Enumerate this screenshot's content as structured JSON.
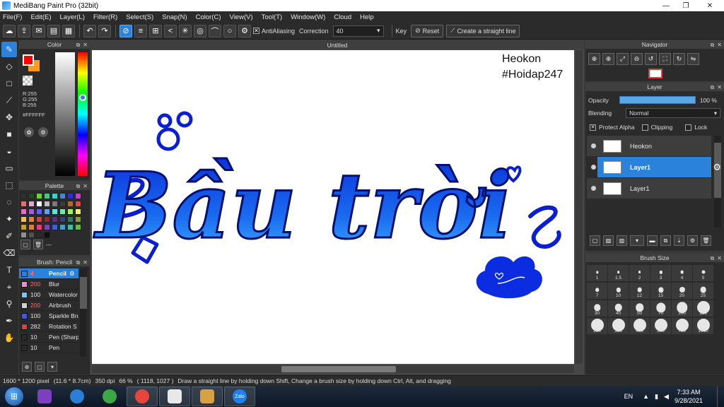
{
  "window": {
    "title": "MediBang Paint Pro (32bit)",
    "minimize": "—",
    "maximize": "❐",
    "close": "✕"
  },
  "menu": [
    "File(F)",
    "Edit(E)",
    "Layer(L)",
    "Filter(R)",
    "Select(S)",
    "Snap(N)",
    "Color(C)",
    "View(V)",
    "Tool(T)",
    "Window(W)",
    "Cloud",
    "Help"
  ],
  "toolbar": {
    "antialiasing_label": "AntiAliasing",
    "antialiasing_checked": true,
    "correction_label": "Correction",
    "correction_value": "40",
    "key_label": "Key",
    "reset_label": "Reset",
    "straight_line_label": "Create a straight line"
  },
  "color_panel": {
    "title": "Color",
    "r": "R:255",
    "g": "G:255",
    "b": "B:255",
    "hex": "#FFFFFF",
    "foreground": "#ff0000",
    "background": "#ff9a1a"
  },
  "palette_panel": {
    "title": "Palette",
    "more": "---",
    "colors": [
      "#2f2f2f",
      "#1f4a1f",
      "#6bd23e",
      "#38cf7f",
      "#3ad0d0",
      "#3a8ae0",
      "#2f2fd0",
      "#d03ad0",
      "#e07070",
      "#f0a0d0",
      "#ffffff",
      "#c0c0c0",
      "#7a7a7a",
      "#3a3a3a",
      "#b06a2a",
      "#f04040",
      "#e070c0",
      "#a060e0",
      "#6060f0",
      "#60a0f0",
      "#60e0e0",
      "#60f0a0",
      "#a0f060",
      "#f0f060",
      "#f0c060",
      "#f07a30",
      "#d04040",
      "#a02030",
      "#603080",
      "#304080",
      "#208060",
      "#80a030",
      "#c0a030",
      "#e08030",
      "#e04080",
      "#8040c0",
      "#4060d0",
      "#40a0d0",
      "#40c0a0",
      "#60c040",
      "#909090",
      "#505050",
      "#2a2a2a",
      "#101010"
    ]
  },
  "brush_panel": {
    "title": "Brush: Pencil",
    "items": [
      {
        "size": "4",
        "name": "Pencil",
        "color": "#2a82da",
        "size_color": "#ff6b6b",
        "active": true
      },
      {
        "size": "200",
        "name": "Blur",
        "color": "#f08ad8",
        "size_color": "#ff6b6b",
        "active": false
      },
      {
        "size": "100",
        "name": "Watercolor",
        "color": "#74c6ff",
        "size_color": "#e6e6e6",
        "active": false
      },
      {
        "size": "200",
        "name": "Airbrush",
        "color": "#d0d0d0",
        "size_color": "#ff6b6b",
        "active": false
      },
      {
        "size": "100",
        "name": "Sparkle Brush",
        "color": "#3a5ae0",
        "size_color": "#e6e6e6",
        "active": false
      },
      {
        "size": "282",
        "name": "Rotation S",
        "color": "#e04040",
        "size_color": "#e6e6e6",
        "active": false
      },
      {
        "size": "10",
        "name": "Pen (Sharp)",
        "color": "#2a2a2a",
        "size_color": "#e6e6e6",
        "active": false
      },
      {
        "size": "10",
        "name": "Pen",
        "color": "#2a2a2a",
        "size_color": "#e6e6e6",
        "active": false
      }
    ]
  },
  "document": {
    "tab_title": "Untitled",
    "watermark_line1": "Heokon",
    "watermark_line2": "#Hoidap247",
    "artwork_text": "Bầu trời"
  },
  "navigator": {
    "title": "Navigator"
  },
  "layer_panel": {
    "title": "Layer",
    "opacity_label": "Opacity",
    "opacity_value": "100 %",
    "opacity_percent": 100,
    "blending_label": "Blending",
    "blending_value": "Normal",
    "protect_alpha": "Protect Alpha",
    "protect_alpha_checked": true,
    "clipping": "Clipping",
    "lock": "Lock",
    "layers": [
      {
        "name": "Heokon",
        "active": false
      },
      {
        "name": "Layer1",
        "active": true
      },
      {
        "name": "Layer1",
        "active": false
      }
    ]
  },
  "brush_size_panel": {
    "title": "Brush Size",
    "sizes": [
      "1",
      "1.5",
      "2",
      "3",
      "4",
      "5",
      "7",
      "10",
      "12",
      "15",
      "20",
      "25",
      "30",
      "40",
      "50",
      "70",
      "100",
      "150",
      "200",
      "300",
      "400",
      "500",
      "700",
      "1000"
    ]
  },
  "status": {
    "pixels": "1600 * 1200 pixel",
    "cm": "(11.6 * 8.7cm)",
    "dpi": "350 dpi",
    "zoom": "66 %",
    "coords": "( 1118, 1027 )",
    "hint": "Draw a straight line by holding down Shift, Change a brush size by holding down Ctrl, Alt, and dragging"
  },
  "taskbar": {
    "lang": "EN",
    "time": "7:33 AM",
    "date": "9/28/2021",
    "apps": [
      {
        "name": "visual-studio",
        "color": "#7b3fbf",
        "open": false
      },
      {
        "name": "internet-explorer",
        "color": "#2a7fd4",
        "open": false
      },
      {
        "name": "360-browser",
        "color": "#3aa845",
        "open": false
      },
      {
        "name": "chrome",
        "color": "#e8453c",
        "open": true
      },
      {
        "name": "medibang",
        "color": "#e8e8e8",
        "open": true
      },
      {
        "name": "paint",
        "color": "#d8a040",
        "open": true
      },
      {
        "name": "zalo",
        "color": "#1d7ff0",
        "open": true
      }
    ],
    "zalo_label": "Zalo"
  }
}
